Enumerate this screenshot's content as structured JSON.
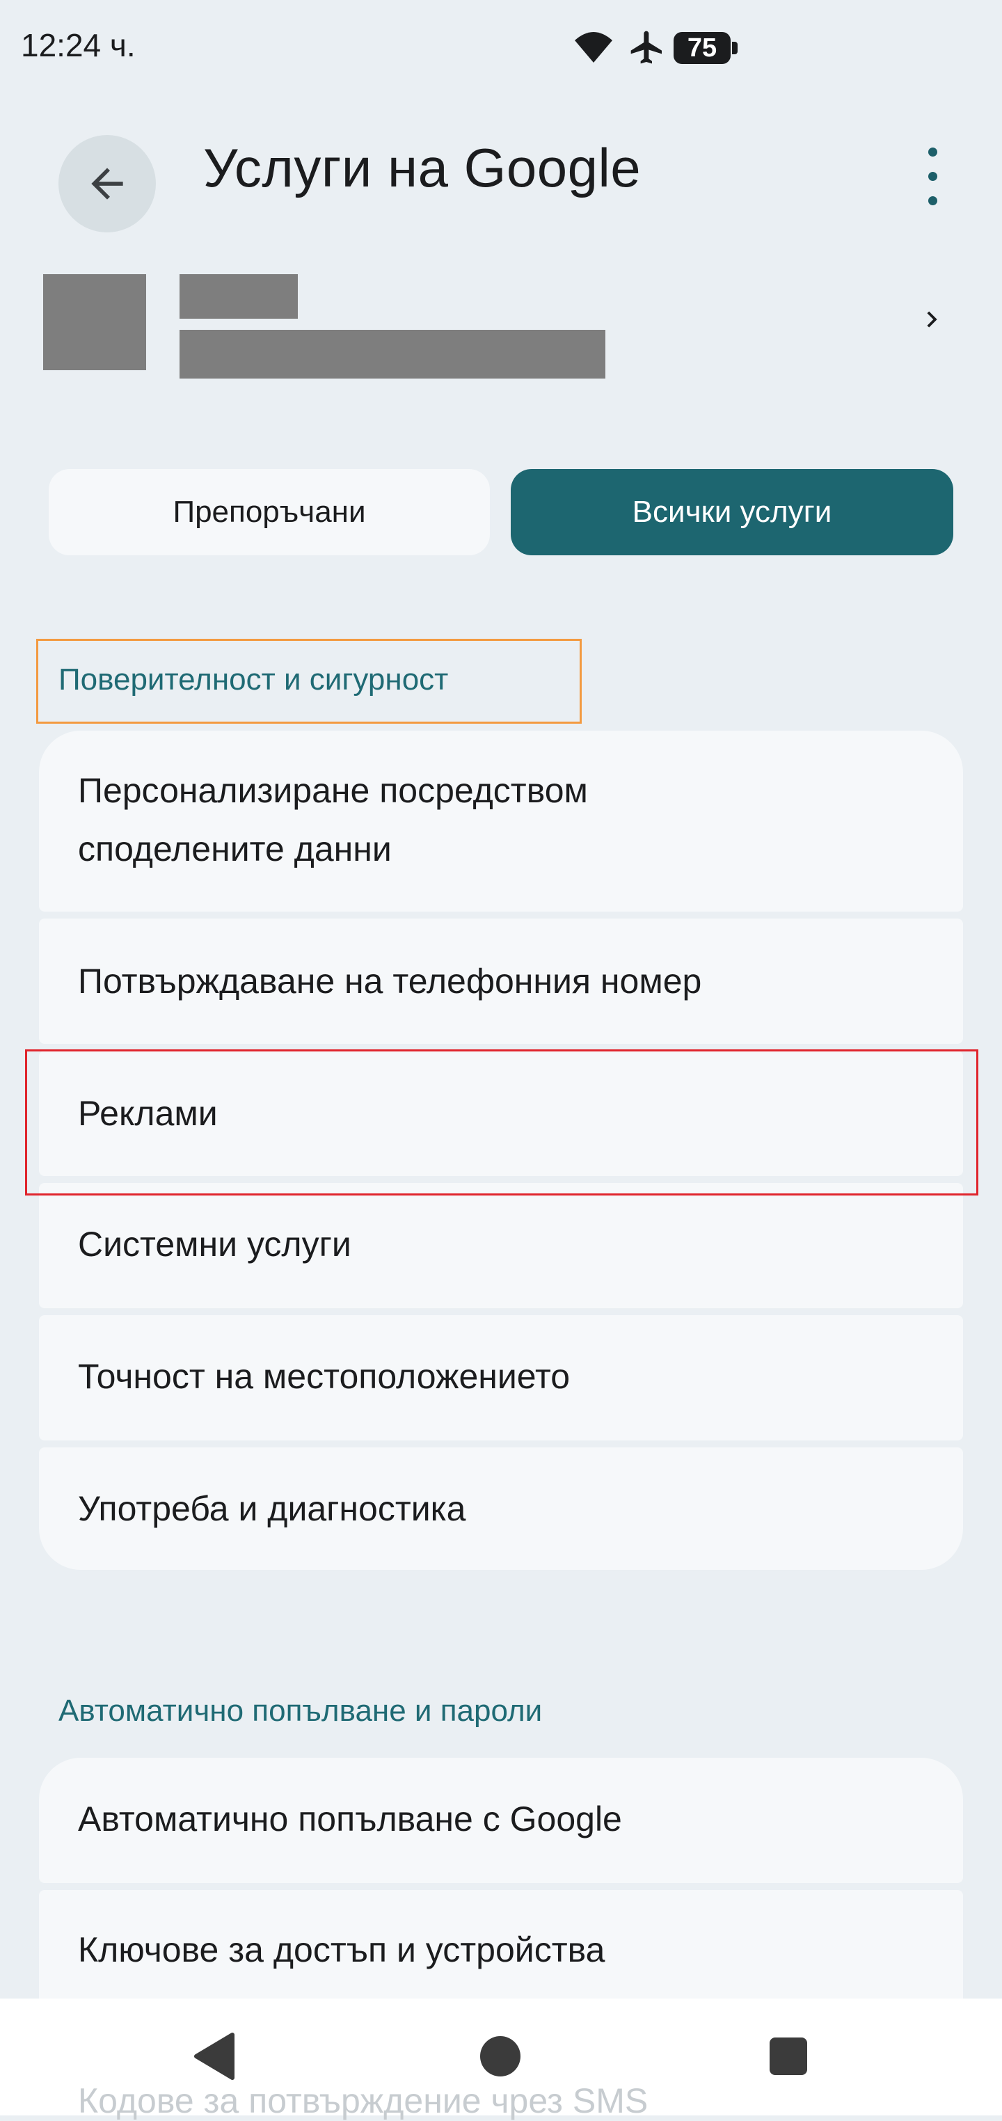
{
  "status_bar": {
    "time": "12:24 ч.",
    "battery_level": "75",
    "icons": [
      "wifi-icon",
      "airplane-icon",
      "battery-icon"
    ]
  },
  "app_bar": {
    "title": "Услуги на Google",
    "back_icon": "arrow-left-icon",
    "menu_icon": "more-vert-icon"
  },
  "tabs": {
    "recommended": "Препоръчани",
    "all": "Всички услуги",
    "selected": "all"
  },
  "sections": [
    {
      "heading": "Поверителност и сигурност",
      "items": [
        {
          "label_line1": "Персонализиране посредством",
          "label_line2": "споделените данни"
        },
        {
          "label": "Потвърждаване на телефонния номер"
        },
        {
          "label": "Реклами"
        },
        {
          "label": "Системни услуги"
        },
        {
          "label": "Точност на местоположението"
        },
        {
          "label": "Употреба и диагностика"
        }
      ]
    },
    {
      "heading": "Автоматично попълване и пароли",
      "items": [
        {
          "label": "Автоматично попълване с Google"
        },
        {
          "label": "Ключове за достъп и устройства"
        },
        {
          "label": "Кодове за потвърждение чрез SMS"
        }
      ]
    }
  ],
  "colors": {
    "background": "#eaeff3",
    "card": "#f6f8fa",
    "accent": "#1d6670",
    "heading": "#1f6a74",
    "highlight_orange": "#f39a40",
    "highlight_red": "#e0242c"
  }
}
